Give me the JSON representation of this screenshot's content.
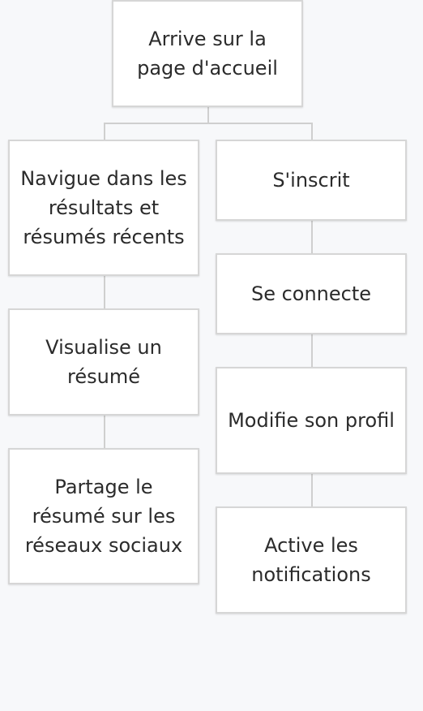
{
  "flowchart": {
    "root": {
      "label": "Arrive sur la page d'accueil"
    },
    "left_branch": [
      {
        "label": "Navigue dans les résultats et résumés récents"
      },
      {
        "label": "Visualise un résumé"
      },
      {
        "label": "Partage le résumé sur les réseaux sociaux"
      }
    ],
    "right_branch": [
      {
        "label": "S'inscrit"
      },
      {
        "label": "Se connecte"
      },
      {
        "label": "Modifie son profil"
      },
      {
        "label": "Active les notifications"
      }
    ]
  }
}
